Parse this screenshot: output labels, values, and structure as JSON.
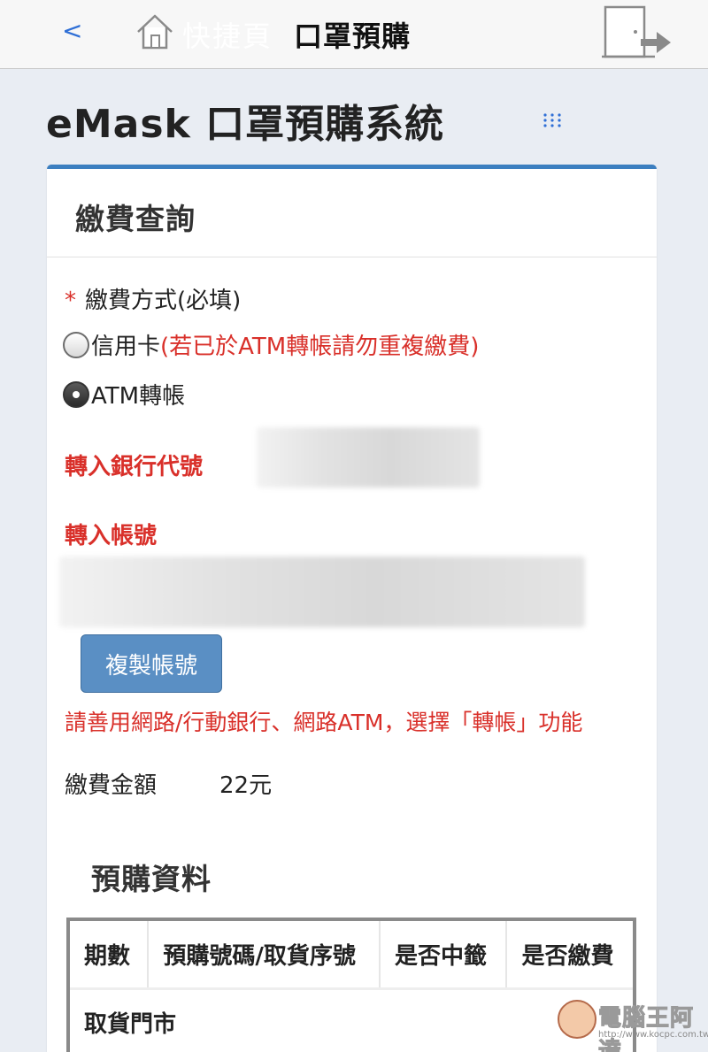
{
  "topbar": {
    "back_label": "<",
    "shortcut_label": "快捷頁",
    "title": "口罩預購"
  },
  "header": {
    "title": "eMask 口罩預購系統"
  },
  "card": {
    "title": "繳費查詢",
    "payment_method_label": "繳費方式(必填)",
    "required_mark": "*",
    "options": [
      {
        "label": "信用卡",
        "note": "(若已於ATM轉帳請勿重複繳費)",
        "checked": false
      },
      {
        "label": "ATM轉帳",
        "note": "",
        "checked": true
      }
    ],
    "bank_code_label": "轉入銀行代號",
    "account_label": "轉入帳號",
    "copy_button_label": "複製帳號",
    "hint": "請善用網路/行動銀行、網路ATM，選擇「轉帳」功能",
    "amount_label": "繳費金額",
    "amount_value": "22元"
  },
  "preorder": {
    "title": "預購資料",
    "columns": [
      "期數",
      "預購號碼/取貨序號",
      "是否中籤",
      "是否繳費"
    ],
    "row2_label": "取貨門市"
  },
  "watermark": {
    "text": "電腦王阿達",
    "url": "http://www.kocpc.com.tw"
  },
  "colors": {
    "accent": "#3c7fc0",
    "required": "#d9302a",
    "button": "#5a8fc4",
    "background": "#e9edf3"
  }
}
